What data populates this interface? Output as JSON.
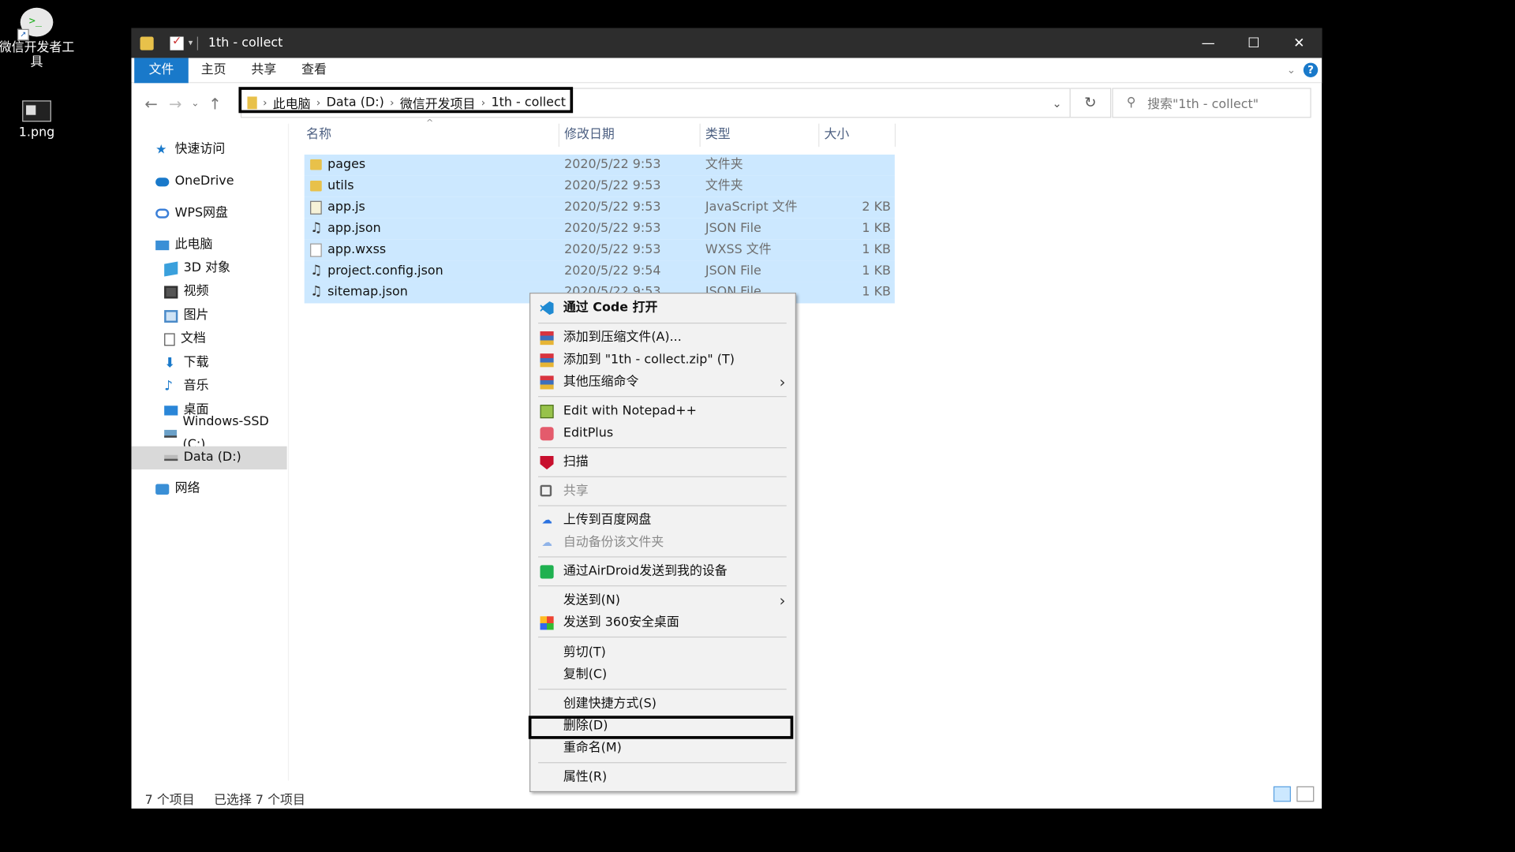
{
  "desktop": {
    "icons": [
      {
        "label": "微信开发者工具",
        "icon": "wechat-devtools-icon"
      },
      {
        "label": "1.png",
        "icon": "image-file-icon"
      }
    ]
  },
  "window": {
    "title": "1th - collect",
    "controls": {
      "minimize": "—",
      "maximize": "☐",
      "close": "✕"
    }
  },
  "ribbon": {
    "tabs": [
      "文件",
      "主页",
      "共享",
      "查看"
    ],
    "help": "?"
  },
  "nav": {
    "back": "←",
    "forward": "→",
    "recent": "⌄",
    "up": "↑",
    "breadcrumb": [
      "此电脑",
      "Data (D:)",
      "微信开发项目",
      "1th - collect"
    ],
    "search_placeholder": "搜索\"1th - collect\""
  },
  "sidebar": {
    "items": [
      {
        "label": "快速访问",
        "icon": "star-icon"
      },
      {
        "label": "OneDrive",
        "icon": "cloud-icon"
      },
      {
        "label": "WPS网盘",
        "icon": "wps-cloud-icon"
      },
      {
        "label": "此电脑",
        "icon": "computer-icon"
      },
      {
        "label": "3D 对象",
        "icon": "3d-objects-icon"
      },
      {
        "label": "视频",
        "icon": "video-icon"
      },
      {
        "label": "图片",
        "icon": "pictures-icon"
      },
      {
        "label": "文档",
        "icon": "documents-icon"
      },
      {
        "label": "下载",
        "icon": "download-icon"
      },
      {
        "label": "音乐",
        "icon": "music-icon"
      },
      {
        "label": "桌面",
        "icon": "desktop-icon"
      },
      {
        "label": "Windows-SSD (C:)",
        "icon": "drive-icon"
      },
      {
        "label": "Data (D:)",
        "icon": "drive-icon",
        "selected": true
      },
      {
        "label": "网络",
        "icon": "network-icon"
      }
    ]
  },
  "filelist": {
    "columns": [
      "名称",
      "修改日期",
      "类型",
      "大小"
    ],
    "rows": [
      {
        "name": "pages",
        "date": "2020/5/22 9:53",
        "type": "文件夹",
        "size": "",
        "icon": "folder-icon"
      },
      {
        "name": "utils",
        "date": "2020/5/22 9:53",
        "type": "文件夹",
        "size": "",
        "icon": "folder-icon"
      },
      {
        "name": "app.js",
        "date": "2020/5/22 9:53",
        "type": "JavaScript 文件",
        "size": "2 KB",
        "icon": "js-file-icon"
      },
      {
        "name": "app.json",
        "date": "2020/5/22 9:53",
        "type": "JSON File",
        "size": "1 KB",
        "icon": "json-file-icon"
      },
      {
        "name": "app.wxss",
        "date": "2020/5/22 9:53",
        "type": "WXSS 文件",
        "size": "1 KB",
        "icon": "text-file-icon"
      },
      {
        "name": "project.config.json",
        "date": "2020/5/22 9:54",
        "type": "JSON File",
        "size": "1 KB",
        "icon": "json-file-icon"
      },
      {
        "name": "sitemap.json",
        "date": "2020/5/22 9:53",
        "type": "JSON File",
        "size": "1 KB",
        "icon": "json-file-icon"
      }
    ]
  },
  "status": {
    "count": "7 个项目",
    "selected": "已选择 7 个项目"
  },
  "context_menu": {
    "items": [
      {
        "label": "通过 Code 打开",
        "icon": "vscode-icon",
        "bold": true
      },
      {
        "label": "添加到压缩文件(A)...",
        "icon": "winrar-icon"
      },
      {
        "label": "添加到 \"1th - collect.zip\" (T)",
        "icon": "winrar-icon"
      },
      {
        "label": "其他压缩命令",
        "icon": "winrar-icon",
        "submenu": true
      },
      {
        "label": "Edit with Notepad++",
        "icon": "notepadpp-icon"
      },
      {
        "label": "EditPlus",
        "icon": "editplus-icon"
      },
      {
        "label": "扫描",
        "icon": "mcafee-icon"
      },
      {
        "label": "共享",
        "icon": "share-icon",
        "disabled": true
      },
      {
        "label": "上传到百度网盘",
        "icon": "baidu-netdisk-icon"
      },
      {
        "label": "自动备份该文件夹",
        "icon": "baidu-netdisk-icon",
        "disabled": true
      },
      {
        "label": "通过AirDroid发送到我的设备",
        "icon": "airdroid-icon"
      },
      {
        "label": "发送到(N)",
        "submenu": true
      },
      {
        "label": "发送到 360安全桌面",
        "icon": "360-icon"
      },
      {
        "label": "剪切(T)"
      },
      {
        "label": "复制(C)"
      },
      {
        "label": "创建快捷方式(S)"
      },
      {
        "label": "删除(D)",
        "highlighted": true
      },
      {
        "label": "重命名(M)"
      },
      {
        "label": "属性(R)"
      }
    ],
    "submenu_arrow": "›"
  }
}
